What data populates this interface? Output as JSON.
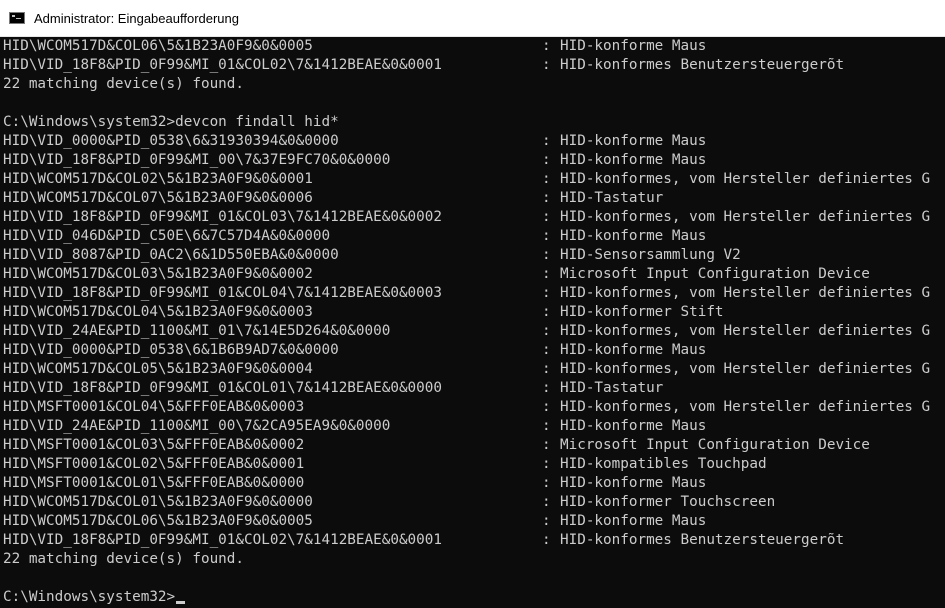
{
  "window": {
    "title": "Administrator: Eingabeaufforderung",
    "icon": "cmd-icon"
  },
  "colors": {
    "console_bg": "#0c0c0c",
    "console_fg": "#cccccc",
    "titlebar_bg": "#ffffff"
  },
  "console": {
    "separator": ":",
    "top_entries": [
      {
        "id": "HID\\WCOM517D&COL06\\5&1B23A0F9&0&0005",
        "desc": "HID-konforme Maus"
      },
      {
        "id": "HID\\VID_18F8&PID_0F99&MI_01&COL02\\7&1412BEAE&0&0001",
        "desc": "HID-konformes Benutzersteuergerõt"
      }
    ],
    "top_summary": "22 matching device(s) found.",
    "command_prompt": "C:\\Windows\\system32>devcon findall hid*",
    "entries": [
      {
        "id": "HID\\VID_0000&PID_0538\\6&31930394&0&0000",
        "desc": "HID-konforme Maus"
      },
      {
        "id": "HID\\VID_18F8&PID_0F99&MI_00\\7&37E9FC70&0&0000",
        "desc": "HID-konforme Maus"
      },
      {
        "id": "HID\\WCOM517D&COL02\\5&1B23A0F9&0&0001",
        "desc": "HID-konformes, vom Hersteller definiertes G"
      },
      {
        "id": "HID\\WCOM517D&COL07\\5&1B23A0F9&0&0006",
        "desc": "HID-Tastatur"
      },
      {
        "id": "HID\\VID_18F8&PID_0F99&MI_01&COL03\\7&1412BEAE&0&0002",
        "desc": "HID-konformes, vom Hersteller definiertes G"
      },
      {
        "id": "HID\\VID_046D&PID_C50E\\6&7C57D4A&0&0000",
        "desc": "HID-konforme Maus"
      },
      {
        "id": "HID\\VID_8087&PID_0AC2\\6&1D550EBA&0&0000",
        "desc": "HID-Sensorsammlung V2"
      },
      {
        "id": "HID\\WCOM517D&COL03\\5&1B23A0F9&0&0002",
        "desc": "Microsoft Input Configuration Device"
      },
      {
        "id": "HID\\VID_18F8&PID_0F99&MI_01&COL04\\7&1412BEAE&0&0003",
        "desc": "HID-konformes, vom Hersteller definiertes G"
      },
      {
        "id": "HID\\WCOM517D&COL04\\5&1B23A0F9&0&0003",
        "desc": "HID-konformer Stift"
      },
      {
        "id": "HID\\VID_24AE&PID_1100&MI_01\\7&14E5D264&0&0000",
        "desc": "HID-konformes, vom Hersteller definiertes G"
      },
      {
        "id": "HID\\VID_0000&PID_0538\\6&1B6B9AD7&0&0000",
        "desc": "HID-konforme Maus"
      },
      {
        "id": "HID\\WCOM517D&COL05\\5&1B23A0F9&0&0004",
        "desc": "HID-konformes, vom Hersteller definiertes G"
      },
      {
        "id": "HID\\VID_18F8&PID_0F99&MI_01&COL01\\7&1412BEAE&0&0000",
        "desc": "HID-Tastatur"
      },
      {
        "id": "HID\\MSFT0001&COL04\\5&FFF0EAB&0&0003",
        "desc": "HID-konformes, vom Hersteller definiertes G"
      },
      {
        "id": "HID\\VID_24AE&PID_1100&MI_00\\7&2CA95EA9&0&0000",
        "desc": "HID-konforme Maus"
      },
      {
        "id": "HID\\MSFT0001&COL03\\5&FFF0EAB&0&0002",
        "desc": "Microsoft Input Configuration Device"
      },
      {
        "id": "HID\\MSFT0001&COL02\\5&FFF0EAB&0&0001",
        "desc": "HID-kompatibles Touchpad"
      },
      {
        "id": "HID\\MSFT0001&COL01\\5&FFF0EAB&0&0000",
        "desc": "HID-konforme Maus"
      },
      {
        "id": "HID\\WCOM517D&COL01\\5&1B23A0F9&0&0000",
        "desc": "HID-konformer Touchscreen"
      },
      {
        "id": "HID\\WCOM517D&COL06\\5&1B23A0F9&0&0005",
        "desc": "HID-konforme Maus"
      },
      {
        "id": "HID\\VID_18F8&PID_0F99&MI_01&COL02\\7&1412BEAE&0&0001",
        "desc": "HID-konformes Benutzersteuergerõt"
      }
    ],
    "summary": "22 matching device(s) found.",
    "final_prompt": "C:\\Windows\\system32>"
  }
}
